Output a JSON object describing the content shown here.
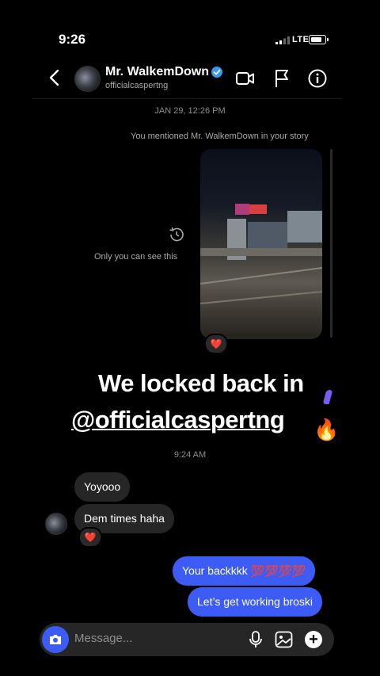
{
  "status_bar": {
    "time": "9:26",
    "network": "LTE"
  },
  "header": {
    "name": "Mr. WalkemDown",
    "handle": "officialcaspertng",
    "icons": [
      "back-chevron-icon",
      "verified-badge-icon",
      "video-call-icon",
      "flag-icon",
      "info-icon"
    ]
  },
  "thread": {
    "date_separator": "JAN 29, 12:26 PM",
    "mention_notice": "You mentioned Mr. WalkemDown in your story",
    "story_reply": {
      "visibility_note": "Only you can see this",
      "reaction": "❤️",
      "sticker_line1": "We locked back in",
      "sticker_line2": "@officialcaspertng",
      "sticker_emoji": "🔥"
    },
    "time_separator": "9:24 AM",
    "incoming": [
      {
        "text": "Yoyooo"
      },
      {
        "text": "Dem times haha",
        "reaction": "❤️"
      }
    ],
    "outgoing": [
      {
        "text": "Your backkkk 💯💯💯💯"
      },
      {
        "text": "Let’s get working broski"
      }
    ]
  },
  "composer": {
    "placeholder": "Message...",
    "icons": [
      "camera-icon",
      "microphone-icon",
      "gallery-icon",
      "add-icon"
    ]
  },
  "colors": {
    "background": "#000000",
    "outgoing_bubble": "#3d5cf5",
    "incoming_bubble": "#262626",
    "verified": "#3897f0"
  }
}
